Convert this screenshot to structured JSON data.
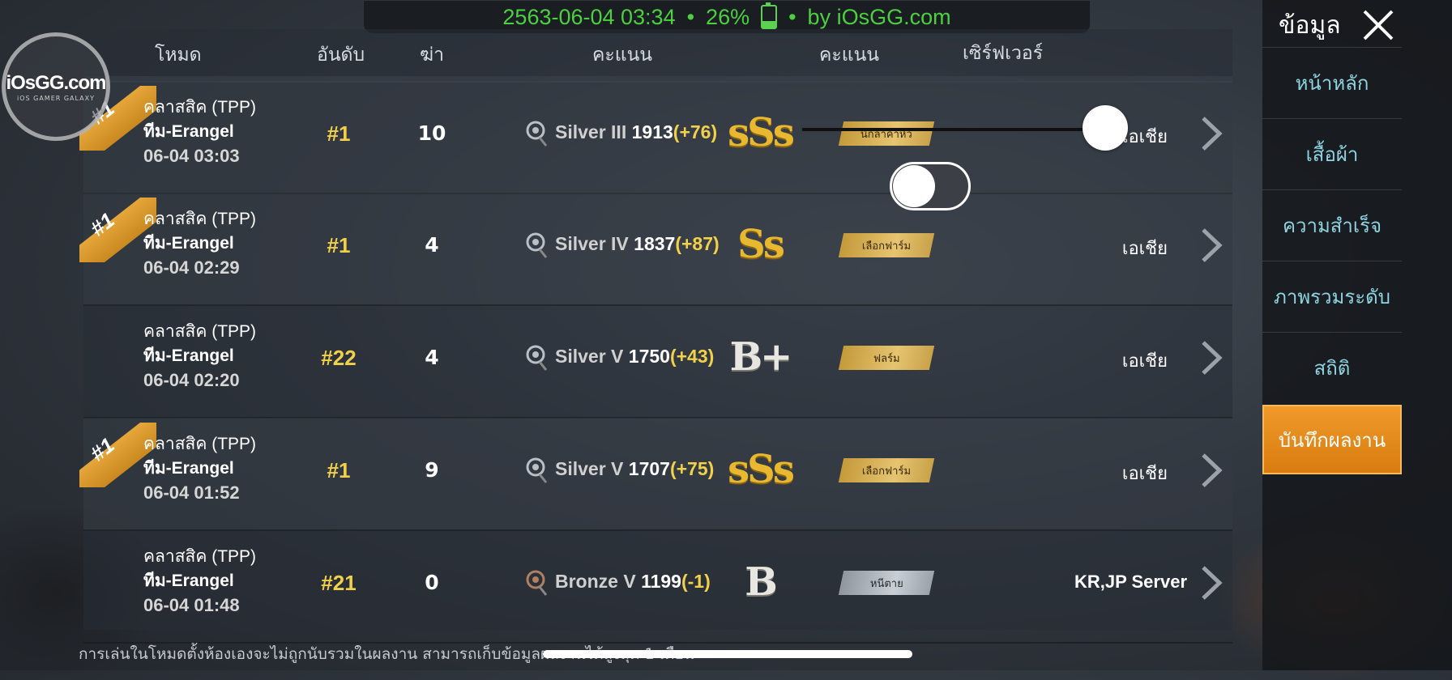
{
  "status": {
    "datetime": "2563-06-04 03:34",
    "battery": "26%",
    "credit": "by iOsGG.com",
    "bullet": "•"
  },
  "logo": {
    "main": "iOsGG.com",
    "sub": "iOS GAMER GALAXY"
  },
  "header": {
    "mode": "โหมด",
    "rank": "อันดับ",
    "kills": "ฆ่า",
    "score": "คะแนน",
    "rating": "คะแนน",
    "server": "เซิร์ฟเวอร์"
  },
  "rows": [
    {
      "chicken": "#1",
      "mode": "คลาสสิค (TPP)",
      "map": "ทีม-Erangel",
      "date": "06-04 03:03",
      "rank": "#1",
      "kills": "10",
      "tier": "Silver III",
      "points": "1913",
      "delta": "(+76)",
      "grade": "sSs",
      "badge": "นักล่าค่าหัว",
      "server": "เอเชีย"
    },
    {
      "chicken": "#1",
      "mode": "คลาสสิค (TPP)",
      "map": "ทีม-Erangel",
      "date": "06-04 02:29",
      "rank": "#1",
      "kills": "4",
      "tier": "Silver IV",
      "points": "1837",
      "delta": "(+87)",
      "grade": "Ss",
      "badge": "เลือกฟาร์ม",
      "server": "เอเชีย"
    },
    {
      "chicken": "",
      "mode": "คลาสสิค (TPP)",
      "map": "ทีม-Erangel",
      "date": "06-04 02:20",
      "rank": "#22",
      "kills": "4",
      "tier": "Silver V",
      "points": "1750",
      "delta": "(+43)",
      "grade": "B+",
      "badge": "ฟลร์ม",
      "server": "เอเชีย"
    },
    {
      "chicken": "#1",
      "mode": "คลาสสิค (TPP)",
      "map": "ทีม-Erangel",
      "date": "06-04 01:52",
      "rank": "#1",
      "kills": "9",
      "tier": "Silver V",
      "points": "1707",
      "delta": "(+75)",
      "grade": "sSs",
      "badge": "เลือกฟาร์ม",
      "server": "เอเชีย"
    },
    {
      "chicken": "",
      "mode": "คลาสสิค (TPP)",
      "map": "ทีม-Erangel",
      "date": "06-04 01:48",
      "rank": "#21",
      "kills": "0",
      "tier": "Bronze V",
      "points": "1199",
      "delta": "(-1)",
      "grade": "B",
      "badge": "หนีตาย",
      "server": "KR,JP Server"
    }
  ],
  "footer": "การเล่นในโหมดตั้งห้องเองจะไม่ถูกนับรวมในผลงาน สามารถเก็บข้อมูลผลงานได้สูงสุด 1 เดือน",
  "sidebar": {
    "title": "ข้อมูล",
    "items": [
      "หน้าหลัก",
      "เสื้อผ้า",
      "ความสำเร็จ",
      "ภาพรวมระดับ",
      "สถิติ",
      "บันทึกผลงาน"
    ],
    "active_index": 5
  },
  "colors": {
    "accent": "#f2d14a",
    "active_tab": "#e88a1a",
    "status_text": "#4cd040",
    "sidebar_link": "#8fd4e0"
  }
}
